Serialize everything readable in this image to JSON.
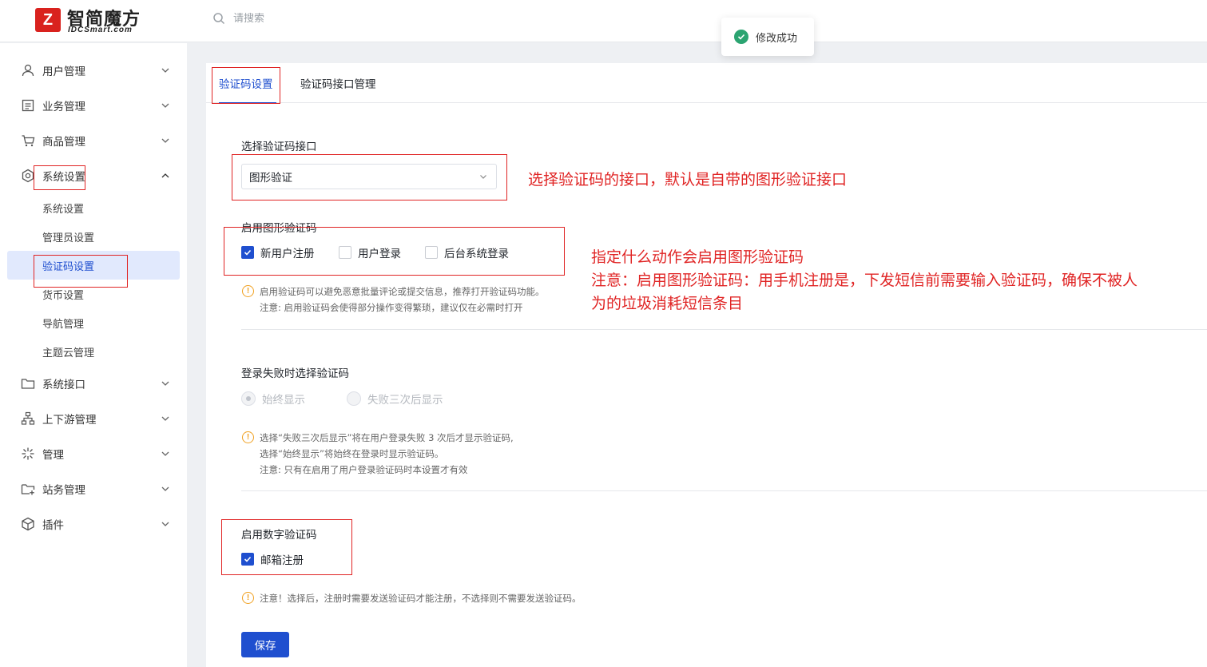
{
  "brand": {
    "name": "智简魔方",
    "sub": "IDCSmart.com",
    "mark": "Z"
  },
  "search": {
    "placeholder": "请搜索"
  },
  "toast": {
    "message": "修改成功"
  },
  "sidebar": {
    "items": [
      {
        "label": "用户管理",
        "icon": "user-icon"
      },
      {
        "label": "业务管理",
        "icon": "document-icon"
      },
      {
        "label": "商品管理",
        "icon": "cart-icon"
      },
      {
        "label": "系统设置",
        "icon": "gear-icon",
        "expanded": true
      },
      {
        "label": "系统接口",
        "icon": "folder-icon"
      },
      {
        "label": "上下游管理",
        "icon": "hierarchy-icon"
      },
      {
        "label": "管理",
        "icon": "sparkle-icon"
      },
      {
        "label": "站务管理",
        "icon": "folder-plus-icon"
      },
      {
        "label": "插件",
        "icon": "cube-icon"
      }
    ],
    "sub_items": [
      {
        "label": "系统设置"
      },
      {
        "label": "管理员设置"
      },
      {
        "label": "验证码设置",
        "active": true
      },
      {
        "label": "货币设置"
      },
      {
        "label": "导航管理"
      },
      {
        "label": "主题云管理"
      }
    ]
  },
  "tabs": [
    {
      "label": "验证码设置",
      "active": true
    },
    {
      "label": "验证码接口管理",
      "active": false
    }
  ],
  "form": {
    "interface_label": "选择验证码接口",
    "interface_value": "图形验证",
    "graphic_label": "启用图形验证码",
    "graphic_options": [
      {
        "label": "新用户注册",
        "checked": true
      },
      {
        "label": "用户登录",
        "checked": false
      },
      {
        "label": "后台系统登录",
        "checked": false
      }
    ],
    "graphic_hint": [
      "启用验证码可以避免恶意批量评论或提交信息，推荐打开验证码功能。",
      "注意: 启用验证码会使得部分操作变得繁琐，建议仅在必需时打开"
    ],
    "login_fail_label": "登录失败时选择验证码",
    "login_fail_options": [
      {
        "label": "始终显示",
        "selected": true
      },
      {
        "label": "失败三次后显示",
        "selected": false
      }
    ],
    "login_fail_hint": [
      "选择“失败三次后显示”将在用户登录失败 3 次后才显示验证码,",
      "选择“始终显示”将始终在登录时显示验证码。",
      "注意: 只有在启用了用户登录验证码时本设置才有效"
    ],
    "numeric_label": "启用数字验证码",
    "numeric_options": [
      {
        "label": "邮箱注册",
        "checked": true
      }
    ],
    "numeric_hint": [
      "注意！选择后，注册时需要发送验证码才能注册，不选择则不需要发送验证码。"
    ],
    "save_label": "保存"
  },
  "annotations": {
    "interface_note": "选择验证码的接口，默认是自带的图形验证接口",
    "graphic_note": [
      "指定什么动作会启用图形验证码",
      "注意：启用图形验证码：用手机注册是，下发短信前需要输入验证码，确保不被人",
      "为的垃圾消耗短信条目"
    ],
    "color": "#e02424"
  },
  "colors": {
    "accent": "#1f4fcf",
    "success": "#2ba471",
    "warning": "#f0a020"
  }
}
